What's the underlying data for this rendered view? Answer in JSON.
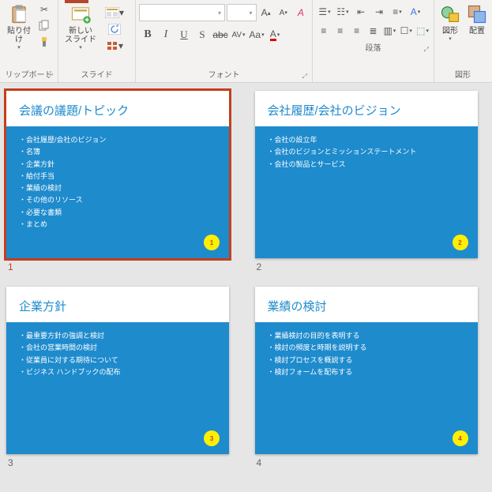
{
  "ribbon": {
    "clipboard": {
      "label": "リップボード",
      "paste": "貼り付け"
    },
    "slides": {
      "label": "スライド",
      "newSlide": "新しい\nスライド"
    },
    "font": {
      "label": "フォント",
      "namePlaceholder": "",
      "sizePlaceholder": "",
      "bold": "B",
      "italic": "I",
      "underline": "U",
      "shadow": "S",
      "strike": "abc",
      "spacing": "AV",
      "case": "Aa",
      "incSize": "A",
      "decSize": "A",
      "clear": "A"
    },
    "paragraph": {
      "label": "段落"
    },
    "drawing": {
      "label": "図形",
      "shapes": "図形",
      "arrange": "配置"
    }
  },
  "slides": [
    {
      "num": "1",
      "selected": true,
      "badge": "1",
      "title": "会議の議題/トピック",
      "bullets": [
        "会社履歴/会社のビジョン",
        "名簿",
        "企業方針",
        "給付手当",
        "業績の検討",
        "その他のリソース",
        "必要な書類",
        "まとめ"
      ]
    },
    {
      "num": "2",
      "selected": false,
      "badge": "2",
      "title": "会社履歴/会社のビジョン",
      "bullets": [
        "会社の設立年",
        "会社のビジョンとミッションステートメント",
        "会社の製品とサービス"
      ]
    },
    {
      "num": "3",
      "selected": false,
      "badge": "3",
      "title": "企業方針",
      "bullets": [
        "最重要方針の強調と検討",
        "会社の営業時間の検討",
        "従業員に対する期待について",
        "ビジネス ハンドブックの配布"
      ]
    },
    {
      "num": "4",
      "selected": false,
      "badge": "4",
      "title": "業績の検討",
      "bullets": [
        "業績検討の目的を表明する",
        "検討の頻度と時期を説明する",
        "検討プロセスを概説する",
        "検討フォームを配布する"
      ]
    }
  ]
}
